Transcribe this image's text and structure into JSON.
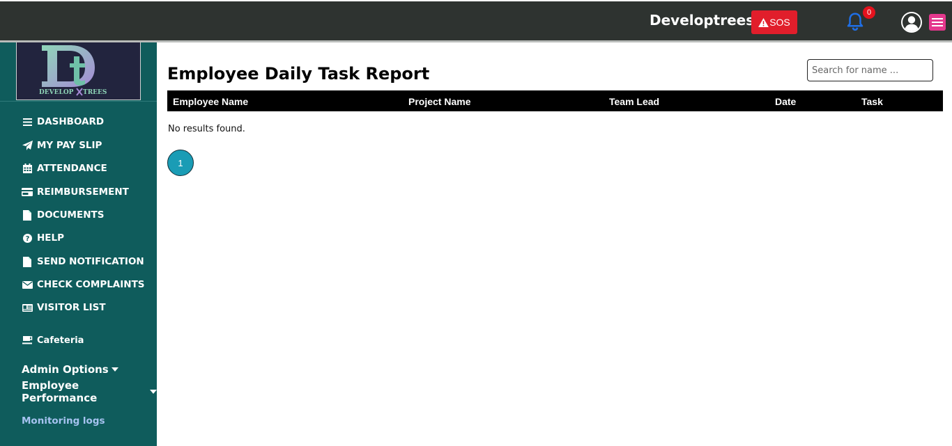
{
  "header": {
    "brand": "Developtrees",
    "sos_label": "SOS",
    "notification_count": "0"
  },
  "sidebar": {
    "logo_text": "DEVELOPTREES",
    "items": [
      {
        "label": "DASHBOARD",
        "icon": "bars-icon"
      },
      {
        "label": "MY PAY SLIP",
        "icon": "paper-plane-icon"
      },
      {
        "label": "ATTENDANCE",
        "icon": "calendar-icon"
      },
      {
        "label": "REIMBURSEMENT",
        "icon": "credit-card-icon"
      },
      {
        "label": "DOCUMENTS",
        "icon": "file-icon"
      },
      {
        "label": "HELP",
        "icon": "question-circle-icon"
      },
      {
        "label": "SEND NOTIFICATION",
        "icon": "file-icon"
      },
      {
        "label": "CHECK COMPLAINTS",
        "icon": "envelope-icon"
      },
      {
        "label": "VISITOR LIST",
        "icon": "id-card-icon"
      },
      {
        "label": "Cafeteria",
        "icon": "coffee-icon"
      }
    ],
    "admin_options": "Admin Options",
    "employee_performance": "Employee Performance",
    "monitoring_logs": "Monitoring logs"
  },
  "main": {
    "title": "Employee Daily Task Report",
    "search_placeholder": "Search for name ...",
    "columns": [
      "Employee Name",
      "Project Name",
      "Team Lead",
      "Date",
      "Task"
    ],
    "empty_message": "No results found.",
    "current_page": "1"
  },
  "colors": {
    "topbar": "#2e3330",
    "sidebar": "#0f5c5c",
    "sos": "#e11e2b",
    "menu_button": "#e4388d",
    "pagination": "#1a9cb5"
  }
}
